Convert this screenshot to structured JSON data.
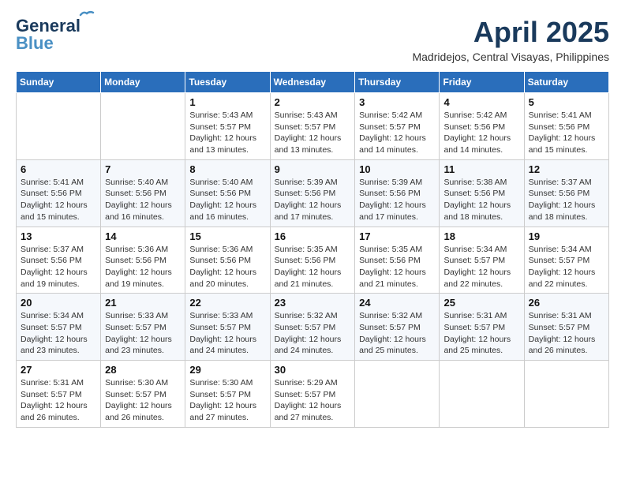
{
  "logo": {
    "line1": "General",
    "line2": "Blue"
  },
  "title": {
    "month_year": "April 2025",
    "location": "Madridejos, Central Visayas, Philippines"
  },
  "headers": [
    "Sunday",
    "Monday",
    "Tuesday",
    "Wednesday",
    "Thursday",
    "Friday",
    "Saturday"
  ],
  "weeks": [
    [
      {
        "day": "",
        "info": ""
      },
      {
        "day": "",
        "info": ""
      },
      {
        "day": "1",
        "info": "Sunrise: 5:43 AM\nSunset: 5:57 PM\nDaylight: 12 hours\nand 13 minutes."
      },
      {
        "day": "2",
        "info": "Sunrise: 5:43 AM\nSunset: 5:57 PM\nDaylight: 12 hours\nand 13 minutes."
      },
      {
        "day": "3",
        "info": "Sunrise: 5:42 AM\nSunset: 5:57 PM\nDaylight: 12 hours\nand 14 minutes."
      },
      {
        "day": "4",
        "info": "Sunrise: 5:42 AM\nSunset: 5:56 PM\nDaylight: 12 hours\nand 14 minutes."
      },
      {
        "day": "5",
        "info": "Sunrise: 5:41 AM\nSunset: 5:56 PM\nDaylight: 12 hours\nand 15 minutes."
      }
    ],
    [
      {
        "day": "6",
        "info": "Sunrise: 5:41 AM\nSunset: 5:56 PM\nDaylight: 12 hours\nand 15 minutes."
      },
      {
        "day": "7",
        "info": "Sunrise: 5:40 AM\nSunset: 5:56 PM\nDaylight: 12 hours\nand 16 minutes."
      },
      {
        "day": "8",
        "info": "Sunrise: 5:40 AM\nSunset: 5:56 PM\nDaylight: 12 hours\nand 16 minutes."
      },
      {
        "day": "9",
        "info": "Sunrise: 5:39 AM\nSunset: 5:56 PM\nDaylight: 12 hours\nand 17 minutes."
      },
      {
        "day": "10",
        "info": "Sunrise: 5:39 AM\nSunset: 5:56 PM\nDaylight: 12 hours\nand 17 minutes."
      },
      {
        "day": "11",
        "info": "Sunrise: 5:38 AM\nSunset: 5:56 PM\nDaylight: 12 hours\nand 18 minutes."
      },
      {
        "day": "12",
        "info": "Sunrise: 5:37 AM\nSunset: 5:56 PM\nDaylight: 12 hours\nand 18 minutes."
      }
    ],
    [
      {
        "day": "13",
        "info": "Sunrise: 5:37 AM\nSunset: 5:56 PM\nDaylight: 12 hours\nand 19 minutes."
      },
      {
        "day": "14",
        "info": "Sunrise: 5:36 AM\nSunset: 5:56 PM\nDaylight: 12 hours\nand 19 minutes."
      },
      {
        "day": "15",
        "info": "Sunrise: 5:36 AM\nSunset: 5:56 PM\nDaylight: 12 hours\nand 20 minutes."
      },
      {
        "day": "16",
        "info": "Sunrise: 5:35 AM\nSunset: 5:56 PM\nDaylight: 12 hours\nand 21 minutes."
      },
      {
        "day": "17",
        "info": "Sunrise: 5:35 AM\nSunset: 5:56 PM\nDaylight: 12 hours\nand 21 minutes."
      },
      {
        "day": "18",
        "info": "Sunrise: 5:34 AM\nSunset: 5:57 PM\nDaylight: 12 hours\nand 22 minutes."
      },
      {
        "day": "19",
        "info": "Sunrise: 5:34 AM\nSunset: 5:57 PM\nDaylight: 12 hours\nand 22 minutes."
      }
    ],
    [
      {
        "day": "20",
        "info": "Sunrise: 5:34 AM\nSunset: 5:57 PM\nDaylight: 12 hours\nand 23 minutes."
      },
      {
        "day": "21",
        "info": "Sunrise: 5:33 AM\nSunset: 5:57 PM\nDaylight: 12 hours\nand 23 minutes."
      },
      {
        "day": "22",
        "info": "Sunrise: 5:33 AM\nSunset: 5:57 PM\nDaylight: 12 hours\nand 24 minutes."
      },
      {
        "day": "23",
        "info": "Sunrise: 5:32 AM\nSunset: 5:57 PM\nDaylight: 12 hours\nand 24 minutes."
      },
      {
        "day": "24",
        "info": "Sunrise: 5:32 AM\nSunset: 5:57 PM\nDaylight: 12 hours\nand 25 minutes."
      },
      {
        "day": "25",
        "info": "Sunrise: 5:31 AM\nSunset: 5:57 PM\nDaylight: 12 hours\nand 25 minutes."
      },
      {
        "day": "26",
        "info": "Sunrise: 5:31 AM\nSunset: 5:57 PM\nDaylight: 12 hours\nand 26 minutes."
      }
    ],
    [
      {
        "day": "27",
        "info": "Sunrise: 5:31 AM\nSunset: 5:57 PM\nDaylight: 12 hours\nand 26 minutes."
      },
      {
        "day": "28",
        "info": "Sunrise: 5:30 AM\nSunset: 5:57 PM\nDaylight: 12 hours\nand 26 minutes."
      },
      {
        "day": "29",
        "info": "Sunrise: 5:30 AM\nSunset: 5:57 PM\nDaylight: 12 hours\nand 27 minutes."
      },
      {
        "day": "30",
        "info": "Sunrise: 5:29 AM\nSunset: 5:57 PM\nDaylight: 12 hours\nand 27 minutes."
      },
      {
        "day": "",
        "info": ""
      },
      {
        "day": "",
        "info": ""
      },
      {
        "day": "",
        "info": ""
      }
    ]
  ]
}
